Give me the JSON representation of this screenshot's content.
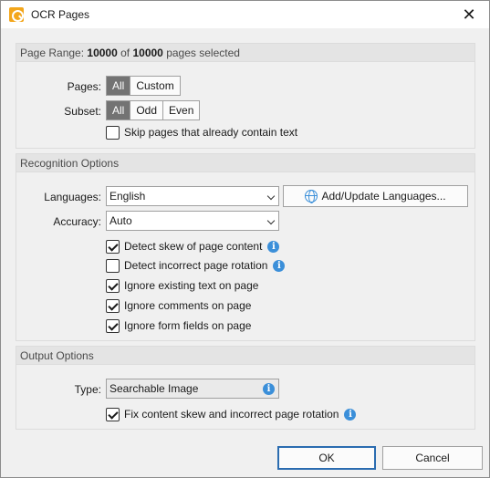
{
  "window": {
    "title": "OCR Pages"
  },
  "page_range": {
    "header_label": "Page Range:",
    "selected_count": "10000",
    "of_text": "of",
    "total_count": "10000",
    "suffix_text": "pages selected",
    "pages_label": "Pages:",
    "pages_options": [
      "All",
      "Custom"
    ],
    "subset_label": "Subset:",
    "subset_options": [
      "All",
      "Odd",
      "Even"
    ],
    "skip_text_label": "Skip pages that already contain text",
    "skip_text_checked": false
  },
  "recognition": {
    "header": "Recognition Options",
    "languages_label": "Languages:",
    "languages_value": "English",
    "add_languages_button": "Add/Update Languages...",
    "accuracy_label": "Accuracy:",
    "accuracy_value": "Auto",
    "options": [
      {
        "label": "Detect skew of page content",
        "checked": true,
        "info": true
      },
      {
        "label": "Detect incorrect page rotation",
        "checked": false,
        "info": true
      },
      {
        "label": "Ignore existing text on page",
        "checked": true,
        "info": false
      },
      {
        "label": "Ignore comments on page",
        "checked": true,
        "info": false
      },
      {
        "label": "Ignore form fields on page",
        "checked": true,
        "info": false
      }
    ]
  },
  "output": {
    "header": "Output Options",
    "type_label": "Type:",
    "type_value": "Searchable Image",
    "fix_rotation_label": "Fix content skew and incorrect page rotation",
    "fix_rotation_checked": true
  },
  "buttons": {
    "ok": "OK",
    "cancel": "Cancel"
  },
  "icons": {
    "app": "ocr-pages-app-icon",
    "close": "close-icon",
    "globe": "globe-icon",
    "info": "info-icon",
    "dropdown": "chevron-down-icon"
  },
  "colors": {
    "segment_active": "#737373",
    "info_blue": "#3b8fd9",
    "default_button_border": "#2b6cb0"
  }
}
